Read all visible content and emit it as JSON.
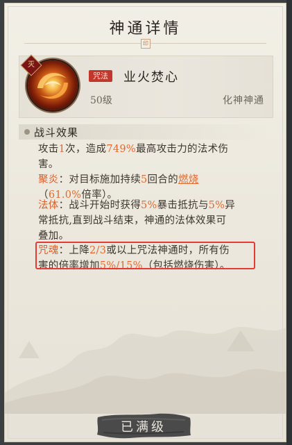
{
  "title": "神通详情",
  "seal_glyph": "印",
  "skill": {
    "corner_badge": "灭",
    "type_tag": "咒法",
    "name": "业火焚心",
    "level": "50级",
    "realm": "化神神通",
    "icon": "fire-ring-icon"
  },
  "section": {
    "title": "战斗效果"
  },
  "effects": {
    "main": {
      "p1": "攻击",
      "count": "1",
      "p2": "次，造成",
      "pct": "749%",
      "p3": "最高攻击力的法术伤",
      "p4": "害。"
    },
    "juyan": {
      "label": "聚炎",
      "p1": "：对目标施加持续",
      "rounds": "5",
      "p2": "回合的",
      "burn": "燃烧",
      "p3": "（",
      "rate": "61.0%",
      "p4": "倍率）。"
    },
    "fati": {
      "label": "法体",
      "p1": "：战斗开始时获得",
      "pct1": "5%",
      "p2": "暴击抵抗与",
      "pct2": "5%",
      "p3": "异",
      "p4": "常抵抗,直到战斗结束，神通的法体效果可",
      "p5": "叠加。"
    },
    "zhouhun": {
      "label": "咒魂",
      "p1": "：上降",
      "frac": "2/3",
      "p2": "或以上咒法神通时，所有伤",
      "p3": "害的倍率增加",
      "pct": "5%/15%",
      "p4": "（包括燃烧伤害）。"
    }
  },
  "button": {
    "label": "已满级"
  },
  "colors": {
    "highlight": "#e06a2e",
    "tag_red": "#c2362c",
    "annotation_box": "#e53935"
  }
}
